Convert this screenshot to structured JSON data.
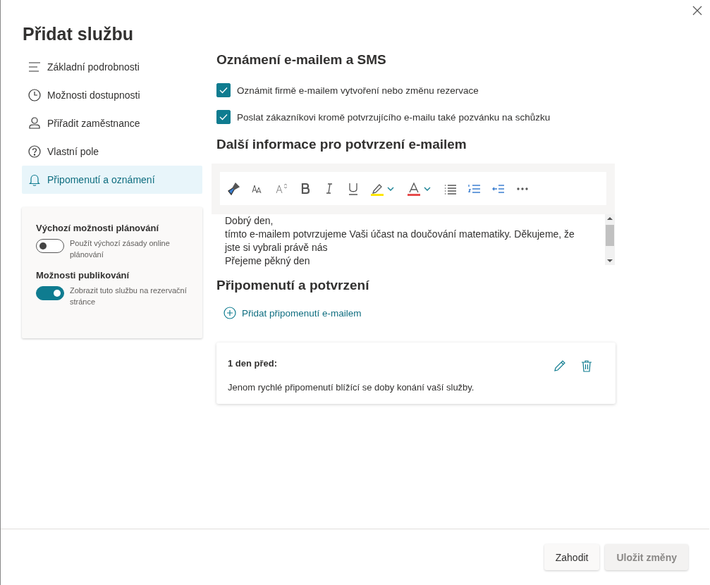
{
  "dialog": {
    "title": "Přidat službu"
  },
  "nav": [
    {
      "kind": "lines",
      "label": "Základní podrobnosti",
      "selected": false
    },
    {
      "kind": "clock",
      "label": "Možnosti dostupnosti",
      "selected": false
    },
    {
      "kind": "person",
      "label": "Přiřadit zaměstnance",
      "selected": false
    },
    {
      "kind": "question",
      "label": "Vlastní pole",
      "selected": false
    },
    {
      "kind": "bell",
      "label": "Připomenutí a oznámení",
      "selected": true
    }
  ],
  "settings": [
    {
      "heading": "Výchozí možnosti plánování",
      "toggle_label": "Použít výchozí zásady online plánování",
      "on": false
    },
    {
      "heading": "Možnosti publikování",
      "toggle_label": "Zobrazit tuto službu na rezervační stránce",
      "on": true
    }
  ],
  "notifications": {
    "heading": "Oznámení e-mailem a SMS",
    "options": [
      {
        "label": "Oznámit firmě e-mailem vytvoření nebo změnu rezervace",
        "checked": true
      },
      {
        "label": "Poslat zákazníkovi kromě potvrzujícího e-mailu také pozvánku na schůzku",
        "checked": true
      }
    ]
  },
  "confirmation": {
    "heading": "Další informace pro potvrzení e-mailem",
    "paragraphs": [
      "Dobrý den,",
      "tímto e-mailem potvrzujeme Vaši účast na doučování matematiky. Děkujeme, že jste si vybrali právě nás",
      "Přejeme pěkný den"
    ]
  },
  "reminders": {
    "heading": "Připomenutí a potvrzení",
    "add_label": "Přidat připomenutí e-mailem",
    "items": [
      {
        "title": "1 den před:",
        "text": "Jenom rychlé připomenutí blížící se doby konání vaší služby."
      }
    ]
  },
  "buttons": [
    {
      "label": "Zahodit",
      "disabled": false
    },
    {
      "label": "Uložit změny",
      "disabled": true
    }
  ]
}
